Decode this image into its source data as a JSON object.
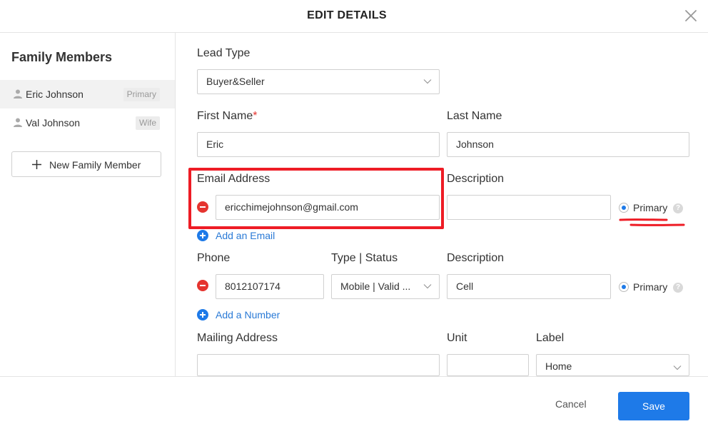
{
  "header": {
    "title": "EDIT DETAILS",
    "close_icon": "close-icon"
  },
  "sidebar": {
    "title": "Family Members",
    "members": [
      {
        "name": "Eric Johnson",
        "badge": "Primary",
        "active": true
      },
      {
        "name": "Val Johnson",
        "badge": "Wife",
        "active": false
      }
    ],
    "new_member_label": "New Family Member"
  },
  "form": {
    "lead_type": {
      "label": "Lead Type",
      "value": "Buyer&Seller"
    },
    "first_name": {
      "label": "First Name",
      "required_mark": "*",
      "value": "Eric"
    },
    "last_name": {
      "label": "Last Name",
      "value": "Johnson"
    },
    "email": {
      "label": "Email Address",
      "value": "ericchimejohnson@gmail.com",
      "description_label": "Description",
      "description_value": "",
      "primary_label": "Primary",
      "primary_selected": true,
      "add_label": "Add an Email"
    },
    "phone": {
      "label": "Phone",
      "type_label": "Type | Status",
      "description_label": "Description",
      "value": "8012107174",
      "type_value": "Mobile | Valid ...",
      "description_value": "Cell",
      "primary_label": "Primary",
      "primary_selected": true,
      "add_label": "Add a Number"
    },
    "mailing": {
      "label": "Mailing Address",
      "unit_label": "Unit",
      "label_label": "Label",
      "value": "",
      "unit_value": "",
      "label_value": "Home"
    }
  },
  "footer": {
    "cancel_label": "Cancel",
    "save_label": "Save"
  },
  "colors": {
    "accent": "#1e7ae8",
    "link": "#2a7ad6",
    "danger": "#e5342f",
    "annotation": "#ee1c25"
  }
}
